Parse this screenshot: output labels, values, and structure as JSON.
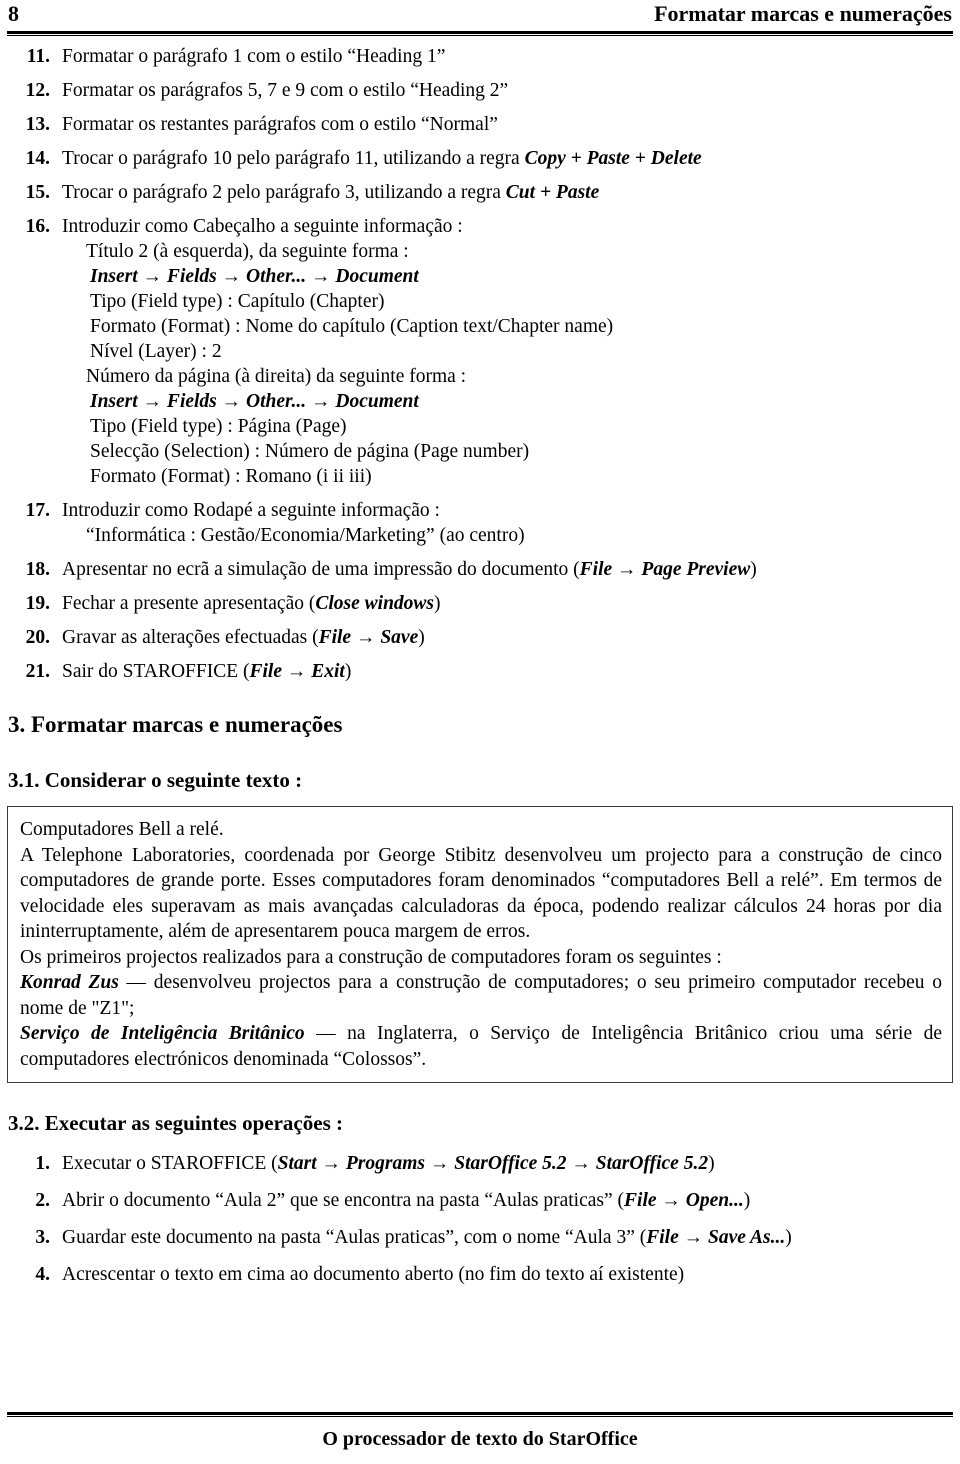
{
  "header": {
    "page_number": "8",
    "title": "Formatar marcas e numerações"
  },
  "list_continued": {
    "items": [
      {
        "num": "11.",
        "text": "Formatar o parágrafo 1 com o estilo “Heading 1”"
      },
      {
        "num": "12.",
        "text": "Formatar os parágrafos 5, 7 e 9 com o estilo “Heading 2”"
      },
      {
        "num": "13.",
        "text": "Formatar os restantes parágrafos com o estilo “Normal”"
      },
      {
        "num": "14.",
        "text_plain": "Trocar o parágrafo 10 pelo parágrafo 11, utilizando a regra ",
        "text_emph": "Copy + Paste + Delete"
      },
      {
        "num": "15.",
        "text_plain": "Trocar o parágrafo 2 pelo parágrafo 3, utilizando a regra ",
        "text_emph": "Cut + Paste"
      }
    ]
  },
  "item16": {
    "num": "16.",
    "lead": "Introduzir como Cabeçalho a seguinte informação :",
    "block_a": {
      "title": "Título 2 (à esquerda), da seguinte forma :",
      "path": "Insert → Fields → Other... → Document",
      "lines": [
        "Tipo (Field type) : Capítulo (Chapter)",
        "Formato (Format) : Nome do capítulo (Caption text/Chapter name)",
        "Nível (Layer) : 2"
      ]
    },
    "block_b": {
      "title": "Número da página (à direita) da seguinte forma :",
      "path": "Insert → Fields → Other... → Document",
      "lines": [
        "Tipo (Field type) : Página (Page)",
        "Selecção (Selection) : Número de página (Page number)",
        "Formato (Format) : Romano (i  ii  iii)"
      ]
    }
  },
  "item17": {
    "num": "17.",
    "lead": "Introduzir como Rodapé a seguinte informação :",
    "sub": "“Informática : Gestão/Economia/Marketing” (ao centro)"
  },
  "list_tail": {
    "items": [
      {
        "num": "18.",
        "pre": "Apresentar no ecrã a simulação de uma impressão do documento  (",
        "emph": "File → Page Preview",
        "post": ")"
      },
      {
        "num": "19.",
        "pre": "Fechar a presente apresentação (",
        "emph": "Close windows",
        "post": ")"
      },
      {
        "num": "20.",
        "pre": "Gravar as alterações efectuadas (",
        "emph": "File → Save",
        "post": ")"
      },
      {
        "num": "21.",
        "pre": "Sair do STAROFFICE (",
        "emph": "File → Exit",
        "post": ")"
      }
    ]
  },
  "section3": {
    "heading": "3. Formatar marcas e numerações",
    "sub31_heading": "3.1. Considerar o seguinte texto :",
    "sub32_heading": "3.2. Executar as seguintes operações :"
  },
  "textbox": {
    "p1": "Computadores Bell a relé.",
    "p2": "A Telephone Laboratories, coordenada por George Stibitz desenvolveu um projecto para a construção de cinco computadores de grande porte. Esses computadores foram denominados “computadores Bell a relé”. Em termos de velocidade eles superavam as mais avançadas calculadoras da época, podendo realizar cálculos 24 horas por dia ininterruptamente, além de apresentarem pouca margem de erros.",
    "p3": "Os primeiros projectos realizados para a construção de computadores foram os seguintes :",
    "p4_emph": "Konrad Zus",
    "p4_rest": " — desenvolveu projectos para a construção de computadores; o seu primeiro computador recebeu o nome de \"Z1\";",
    "p5_emph": "Serviço de Inteligência Britânico",
    "p5_rest": " — na Inglaterra, o Serviço de Inteligência Britânico criou uma série de computadores electrónicos denominada “Colossos”."
  },
  "ops": {
    "items": [
      {
        "num": "1.",
        "pre": "Executar o STAROFFICE (",
        "emph": "Start → Programs → StarOffice 5.2 → StarOffice 5.2",
        "post": ")"
      },
      {
        "num": "2.",
        "pre": "Abrir o documento “Aula 2” que se encontra na pasta “Aulas praticas” (",
        "emph": "File → Open...",
        "post": ")"
      },
      {
        "num": "3.",
        "pre": "Guardar este documento na pasta “Aulas praticas”, com o nome “Aula 3” (",
        "emph": "File → Save As...",
        "post": ")"
      },
      {
        "num": "4.",
        "pre": "Acrescentar o texto em cima ao documento aberto (no fim do texto aí existente)",
        "emph": "",
        "post": ""
      }
    ]
  },
  "footer": {
    "text": "O processador de texto do StarOffice"
  }
}
